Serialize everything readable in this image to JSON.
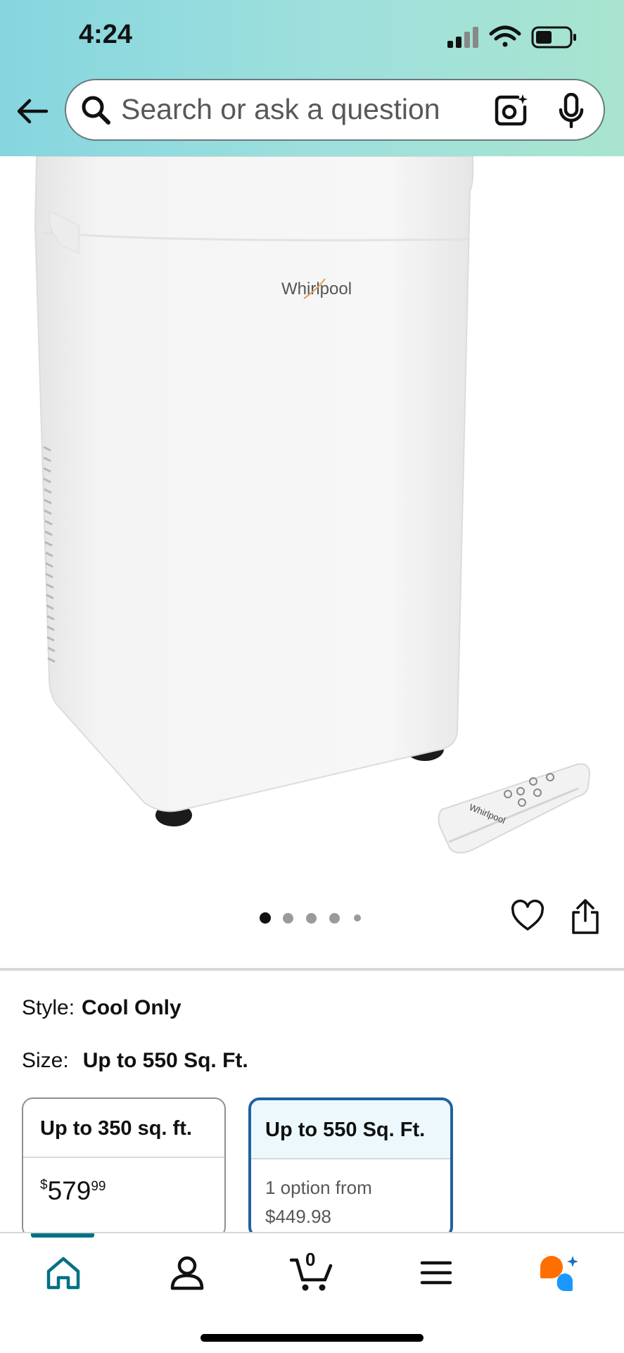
{
  "status_bar": {
    "time": "4:24"
  },
  "search": {
    "placeholder": "Search or ask a question"
  },
  "carousel": {
    "total_dots": 5,
    "active_index": 0
  },
  "product_image": {
    "brand_logo_text": "Whirlpool"
  },
  "variations": {
    "style_label": "Style:",
    "style_value": "Cool Only",
    "size_label": "Size:",
    "size_value": "Up to 550 Sq. Ft."
  },
  "size_options": [
    {
      "title": "Up to 350 sq. ft.",
      "price_symbol": "$",
      "price_whole": "579",
      "price_fraction": "99",
      "selected": false
    },
    {
      "title": "Up to 550 Sq. Ft.",
      "offer_line": "1 option from",
      "offer_price": "$449.98",
      "selected": true
    }
  ],
  "bottom_nav": {
    "cart_count": "0",
    "items": [
      "home-icon",
      "account-icon",
      "cart-icon",
      "menu-icon",
      "rufus-icon"
    ]
  },
  "colors": {
    "accent_teal": "#007185",
    "selected_border": "#2162a1",
    "rufus_orange": "#ff6f00",
    "rufus_blue": "#1a98ff"
  }
}
